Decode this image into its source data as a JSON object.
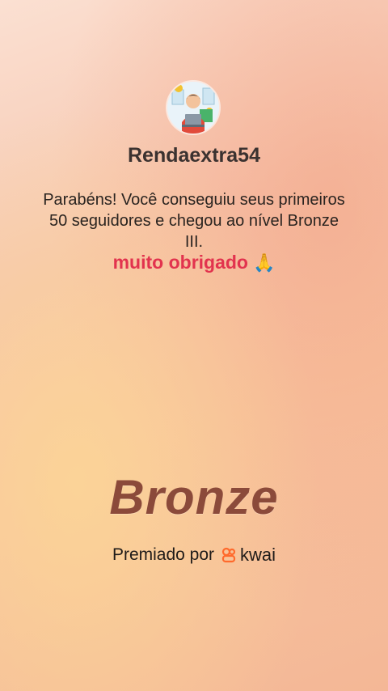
{
  "profile": {
    "username": "Rendaextra54"
  },
  "achievement": {
    "message": "Parabéns! Você conseguiu seus primeiros 50 seguidores e chegou ao nível Bronze III.",
    "thanks": "muito obrigado",
    "thanks_emoji": "🙏",
    "level": "Bronze"
  },
  "footer": {
    "awarded_by": "Premiado por",
    "brand": "kwai",
    "brand_color": "#ff6a2c"
  },
  "colors": {
    "thanks": "#e2334e",
    "level": "#8b4a3a"
  }
}
